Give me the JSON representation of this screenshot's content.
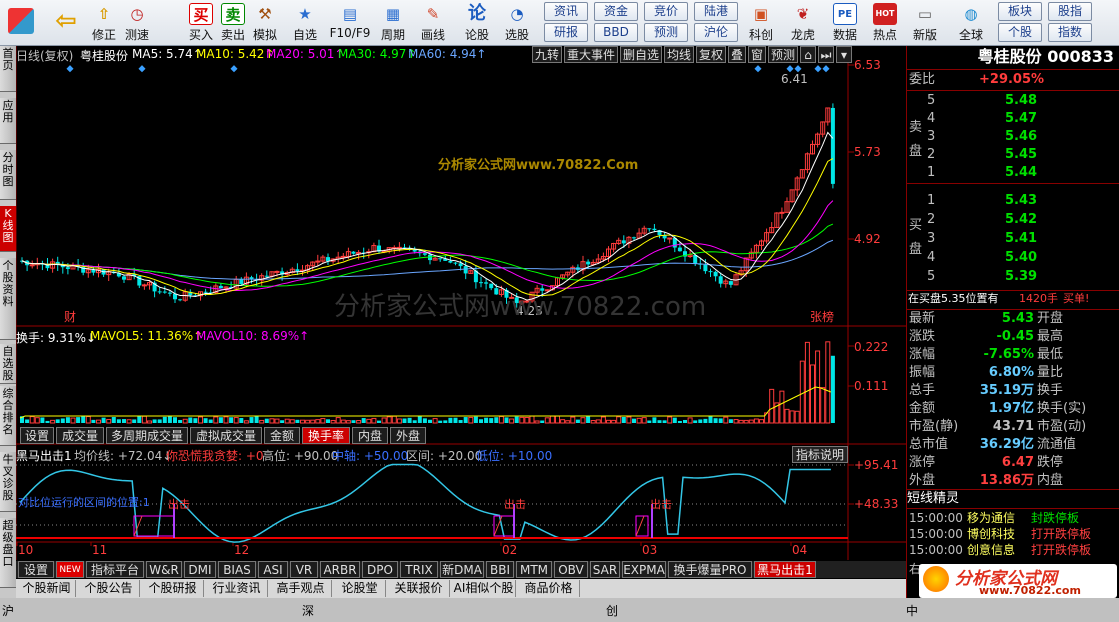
{
  "toolbar": {
    "items": [
      {
        "label": "修正",
        "icon": "up-arrow-icon"
      },
      {
        "label": "测速",
        "icon": "clock-icon"
      },
      {
        "label": "买入",
        "icon": "buy-icon",
        "glyph": "买"
      },
      {
        "label": "卖出",
        "icon": "sell-icon",
        "glyph": "卖"
      },
      {
        "label": "模拟",
        "icon": "hammer-icon"
      },
      {
        "label": "自选",
        "icon": "star-folder-icon"
      },
      {
        "label": "F10/F9",
        "icon": "window-icon"
      },
      {
        "label": "周期",
        "icon": "grid-icon"
      },
      {
        "label": "画线",
        "icon": "pencil-icon"
      },
      {
        "label": "论股",
        "icon": "discuss-icon",
        "glyph": "论"
      },
      {
        "label": "选股",
        "icon": "chart-search-icon"
      }
    ],
    "small_buttons": [
      "资讯",
      "资金",
      "竞价",
      "陆港",
      "研报",
      "BBD",
      "预测",
      "沪伦"
    ],
    "right_items": [
      {
        "label": "科创"
      },
      {
        "label": "龙虎"
      },
      {
        "label": "数据"
      },
      {
        "label": "热点"
      },
      {
        "label": "新版"
      },
      {
        "label": "全球"
      }
    ],
    "right_buttons": [
      "板块",
      "股指",
      "个股",
      "指数"
    ],
    "pe_glyph": "PE",
    "hot_glyph": "HOT"
  },
  "leftnav": [
    "首页",
    "应用",
    "分时图",
    "K线图",
    "个股资料",
    "自选股",
    "综合排名",
    "牛叉诊股",
    "超级盘口"
  ],
  "kline": {
    "header": {
      "mode": "日线(复权)",
      "stock": "粤桂股份",
      "ma5": "MA5: 5.74↑",
      "ma10": "MA10: 5.42↑",
      "ma20": "MA20: 5.01↑",
      "ma30": "MA30: 4.97↑",
      "ma60": "MA60: 4.94↑"
    },
    "toolbar": [
      "九转",
      "重大事件",
      "删自选",
      "均线",
      "复权",
      "叠",
      "窗",
      "预测"
    ],
    "price_ticks": [
      "6.53",
      "5.73",
      "4.92"
    ],
    "high_label": "6.41",
    "low_label": "4.23",
    "watermark": "分析家公式网www.70822.com",
    "watermark_small": "分析家公式网www.70822.Com",
    "badge_cai": "财",
    "badge_zhang": "张榜"
  },
  "volume": {
    "header": {
      "hs": "换手: 9.31%↓",
      "mavol5": "MAVOL5: 11.36%↑",
      "mavol10": "MAVOL10: 8.69%↑"
    },
    "ticks": [
      "0.222",
      "0.111"
    ]
  },
  "tabs_mid": [
    "设置",
    "成交量",
    "多周期成交量",
    "虚拟成交量",
    "金额",
    "换手率",
    "内盘",
    "外盘"
  ],
  "tabs_mid_active": "换手率",
  "indicator": {
    "name": "黑马出击1",
    "avg": "均价线: +72.04↓",
    "fear": "你恐慌我贪婪: +0",
    "high": "高位: +90.00",
    "mid_a": "中轴: +50.00",
    "interval": "区间: +20.00",
    "low_a": "低位: +10.00",
    "desc_btn": "指标说明",
    "ticks": [
      "+95.41",
      "+48.33"
    ],
    "note": "对比位运行的区间的位置:1",
    "signal": "出击"
  },
  "date_axis": [
    "10",
    "11",
    "12",
    "02",
    "03",
    "04"
  ],
  "tabs_bottom": [
    "设置",
    "NEW",
    "指标平台",
    "W&R",
    "DMI",
    "BIAS",
    "ASI",
    "VR",
    "ARBR",
    "DPO",
    "TRIX",
    "新DMA",
    "BBI",
    "MTM",
    "OBV",
    "SAR",
    "EXPMA",
    "换手爆量PRO",
    "黑马出击1"
  ],
  "tabs_bottom_active": "黑马出击1",
  "tabs_news": [
    "个股新闻",
    "个股公告",
    "个股研报",
    "行业资讯",
    "高手观点",
    "论股堂",
    "关联报价",
    "AI相似个股",
    "商品价格"
  ],
  "status": {
    "a": "沪",
    "b": "深",
    "c": "创",
    "d": "中"
  },
  "right": {
    "title": "粤桂股份 000833",
    "weibi_label": "委比",
    "weibi": "+29.05%",
    "sell_label": "卖盘",
    "buy_label": "买盘",
    "sells": [
      {
        "n": "5",
        "p": "5.48"
      },
      {
        "n": "4",
        "p": "5.47"
      },
      {
        "n": "3",
        "p": "5.46"
      },
      {
        "n": "2",
        "p": "5.45"
      },
      {
        "n": "1",
        "p": "5.44"
      }
    ],
    "buys": [
      {
        "n": "1",
        "p": "5.43"
      },
      {
        "n": "2",
        "p": "5.42"
      },
      {
        "n": "3",
        "p": "5.41"
      },
      {
        "n": "4",
        "p": "5.40"
      },
      {
        "n": "5",
        "p": "5.39"
      }
    ],
    "order_note": "在买盘5.35位置有",
    "order_qty": "1420手",
    "order_act": "买单!",
    "stats": [
      {
        "l": "最新",
        "v": "5.43",
        "r": "开盘",
        "c": "#00e000"
      },
      {
        "l": "涨跌",
        "v": "-0.45",
        "r": "最高",
        "c": "#00e000"
      },
      {
        "l": "涨幅",
        "v": "-7.65%",
        "r": "最低",
        "c": "#00e000"
      },
      {
        "l": "振幅",
        "v": "6.80%",
        "r": "量比",
        "c": "#66ccff"
      },
      {
        "l": "总手",
        "v": "35.19万",
        "r": "换手",
        "c": "#66ccff"
      },
      {
        "l": "金额",
        "v": "1.97亿",
        "r": "换手(实)",
        "c": "#66ccff"
      },
      {
        "l": "市盈(静)",
        "v": "43.71",
        "r": "市盈(动)",
        "c": "#c0c0c0"
      },
      {
        "l": "总市值",
        "v": "36.29亿",
        "r": "流通值",
        "c": "#66ccff"
      },
      {
        "l": "涨停",
        "v": "6.47",
        "r": "跌停",
        "c": "#ff4040"
      },
      {
        "l": "外盘",
        "v": "13.86万",
        "r": "内盘",
        "c": "#ff4040"
      }
    ],
    "short_title": "短线精灵",
    "short": [
      {
        "t": "15:00:00",
        "n": "移为通信",
        "e": "封跌停板",
        "c": "#00e000"
      },
      {
        "t": "15:00:00",
        "n": "博创科技",
        "e": "打开跌停板",
        "c": "#ff4040"
      },
      {
        "t": "15:00:00",
        "n": "创意信息",
        "e": "打开跌停板",
        "c": "#ff4040"
      }
    ],
    "logo": "分析家公式网",
    "logo_url": "www.70822.com",
    "bottom_text": "右"
  },
  "colors": {
    "up": "#ff3c3c",
    "down": "#00e6e6",
    "ma5": "#ffffff",
    "ma10": "#ffff00",
    "ma20": "#ff00ff",
    "ma30": "#00ff00",
    "ma60": "#6aa6ff"
  }
}
